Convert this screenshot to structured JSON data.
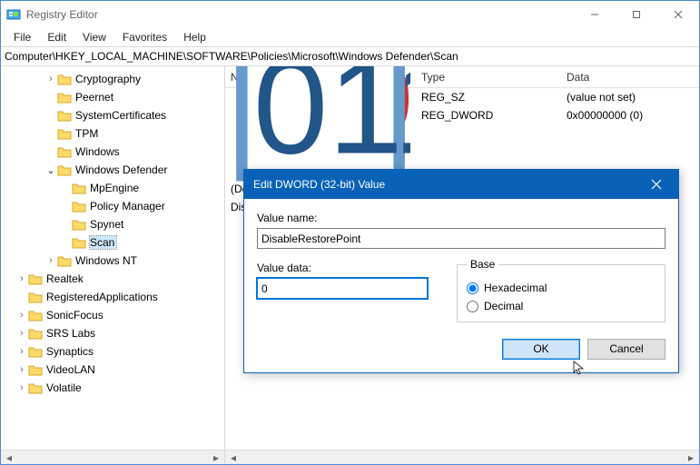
{
  "window": {
    "title": "Registry Editor"
  },
  "menu": {
    "file": "File",
    "edit": "Edit",
    "view": "View",
    "favorites": "Favorites",
    "help": "Help"
  },
  "address": "Computer\\HKEY_LOCAL_MACHINE\\SOFTWARE\\Policies\\Microsoft\\Windows Defender\\Scan",
  "tree": {
    "cryptography": "Cryptography",
    "peernet": "Peernet",
    "systemcertificates": "SystemCertificates",
    "tpm": "TPM",
    "windows": "Windows",
    "windows_defender": "Windows Defender",
    "mpengine": "MpEngine",
    "policy_manager": "Policy Manager",
    "spynet": "Spynet",
    "scan": "Scan",
    "windows_nt": "Windows NT",
    "realtek": "Realtek",
    "registeredapplications": "RegisteredApplications",
    "sonicfocus": "SonicFocus",
    "srs_labs": "SRS Labs",
    "synaptics": "Synaptics",
    "videolan": "VideoLAN",
    "volatile": "Volatile"
  },
  "list": {
    "headers": {
      "name": "Name",
      "type": "Type",
      "data": "Data"
    },
    "rows": [
      {
        "name": "(Default)",
        "type": "REG_SZ",
        "data": "(value not set)",
        "icon": "string"
      },
      {
        "name": "DisableRestorePoint",
        "type": "REG_DWORD",
        "data": "0x00000000 (0)",
        "icon": "dword"
      }
    ]
  },
  "dialog": {
    "title": "Edit DWORD (32-bit) Value",
    "value_name_label": "Value name:",
    "value_name": "DisableRestorePoint",
    "value_data_label": "Value data:",
    "value_data": "0",
    "base_label": "Base",
    "hex_label": "Hexadecimal",
    "dec_label": "Decimal",
    "ok": "OK",
    "cancel": "Cancel"
  }
}
